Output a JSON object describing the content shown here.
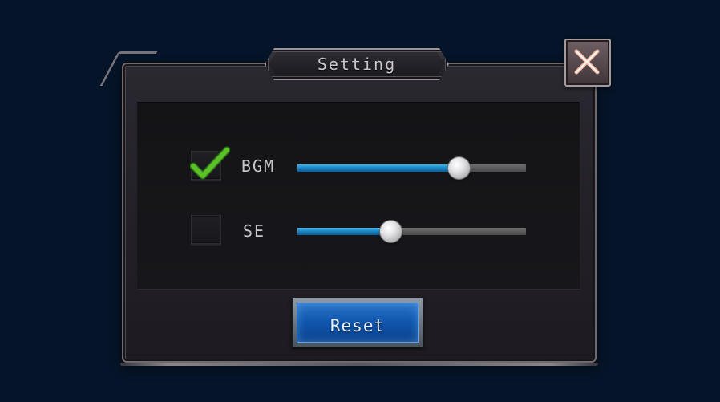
{
  "dialog": {
    "title": "Setting",
    "close_icon": "close-x-icon",
    "reset_label": "Reset"
  },
  "settings": {
    "bgm": {
      "label": "BGM",
      "enabled": true,
      "volume_fraction": 0.71
    },
    "se": {
      "label": "SE",
      "enabled": false,
      "volume_fraction": 0.41
    }
  },
  "colors": {
    "background": "#051428",
    "slider_fill": "#1a84c4",
    "checkmark": "#5bc02a",
    "reset_button": "#1158b0",
    "close_x": "#f0b9a4"
  }
}
